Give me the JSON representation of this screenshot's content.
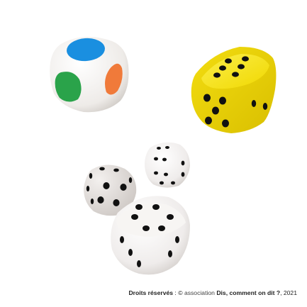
{
  "image": {
    "objects": [
      {
        "name": "color-die",
        "faces": [
          "blue",
          "green",
          "orange"
        ],
        "colors": [
          "#f2f0ee",
          "#1a8fe0",
          "#2aa34a",
          "#f07a3a"
        ]
      },
      {
        "name": "yellow-die",
        "color": "#f4e21a",
        "pip_color": "#111111"
      },
      {
        "name": "white-die-small",
        "color": "#f5f3f1",
        "pip_color": "#111111"
      },
      {
        "name": "white-die-medium",
        "color": "#f5f3f1",
        "pip_color": "#111111"
      },
      {
        "name": "white-die-large",
        "color": "#f5f3f1",
        "pip_color": "#111111"
      }
    ]
  },
  "credit": {
    "label": "Droits réservés",
    "separator": " : © ",
    "org_prefix": "association ",
    "org_name": "Dis, comment on dit ?",
    "year": ", 2021"
  }
}
